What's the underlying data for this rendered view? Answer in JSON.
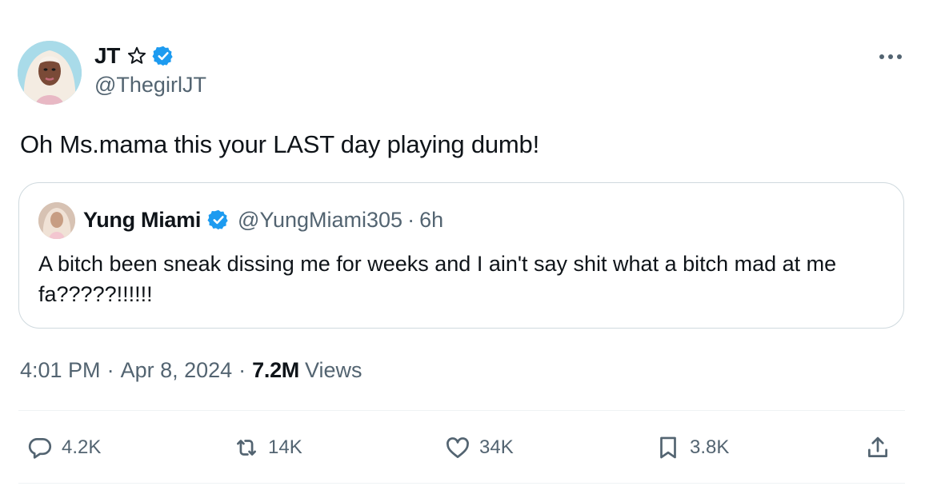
{
  "author": {
    "name": "JT",
    "handle": "@ThegirlJT",
    "avatar_icon": "profile-photo",
    "badge_icons": [
      "star-outline-icon",
      "verified-badge-icon"
    ],
    "verified_color": "#1d9bf0"
  },
  "tweet": {
    "text": "Oh Ms.mama this your LAST day playing dumb!"
  },
  "quote": {
    "name": "Yung Miami",
    "handle": "@YungMiami305",
    "separator": "·",
    "time": "6h",
    "text": "A bitch been sneak dissing me for weeks and I ain't say shit what a bitch mad at me fa?????!!!!!!"
  },
  "meta": {
    "time": "4:01 PM",
    "separator": "·",
    "date": "Apr 8, 2024",
    "views_count": "7.2M",
    "views_label": "Views"
  },
  "actions": {
    "reply": {
      "icon": "reply-icon",
      "count": "4.2K"
    },
    "retweet": {
      "icon": "retweet-icon",
      "count": "14K"
    },
    "like": {
      "icon": "heart-icon",
      "count": "34K"
    },
    "bookmark": {
      "icon": "bookmark-icon",
      "count": "3.8K"
    },
    "share": {
      "icon": "share-icon"
    }
  },
  "colors": {
    "text": "#0f1419",
    "secondary": "#536471",
    "border": "#cfd9de",
    "divider": "#eff3f4",
    "accent": "#1d9bf0"
  }
}
